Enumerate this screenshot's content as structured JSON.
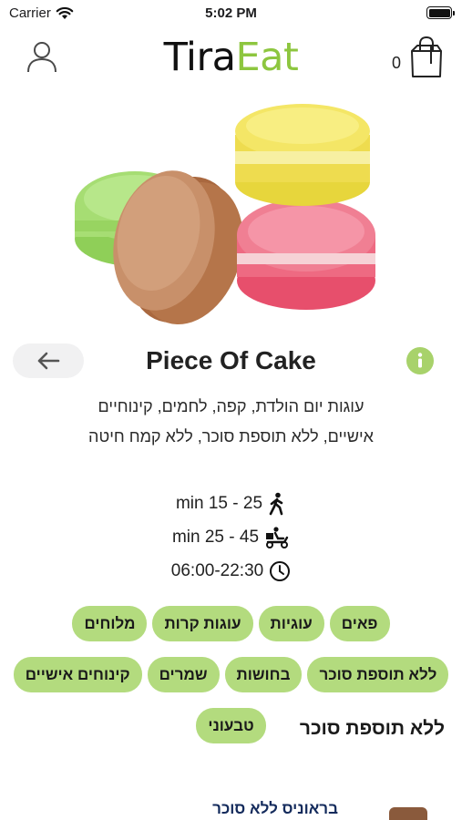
{
  "status_bar": {
    "carrier": "Carrier",
    "time": "5:02 PM"
  },
  "nav": {
    "logo_part1": "Tira",
    "logo_part2": "Eat",
    "cart_count": "0"
  },
  "restaurant": {
    "name": "Piece Of Cake",
    "description": "עוגות יום הולדת, קפה, לחמים, קינוחיים אישיים, ללא תוספת סוכר, ללא קמח חיטה",
    "pickup_time": "min 15 - 25",
    "delivery_time": "min 25 - 45",
    "hours": "06:00-22:30"
  },
  "tags": [
    "פאים",
    "עוגיות",
    "עוגות קרות",
    "מלוחים",
    "ללא תוספת סוכר",
    "בחושות",
    "שמרים",
    "קינוחים אישיים",
    "טבעוני"
  ],
  "section": {
    "title": "ללא תוספת סוכר"
  },
  "product_peek": {
    "name": "בראוניס ללא סוכר"
  },
  "colors": {
    "accent_green": "#8dc63f",
    "tag_bg": "#b3db7e",
    "info_bg": "#a8d26b"
  },
  "icons": {
    "account": "person-outline-icon",
    "cart": "shopping-bag-icon",
    "back": "arrow-left-icon",
    "info": "info-icon",
    "pickup": "walking-person-icon",
    "delivery": "delivery-scooter-icon",
    "hours": "clock-icon"
  }
}
